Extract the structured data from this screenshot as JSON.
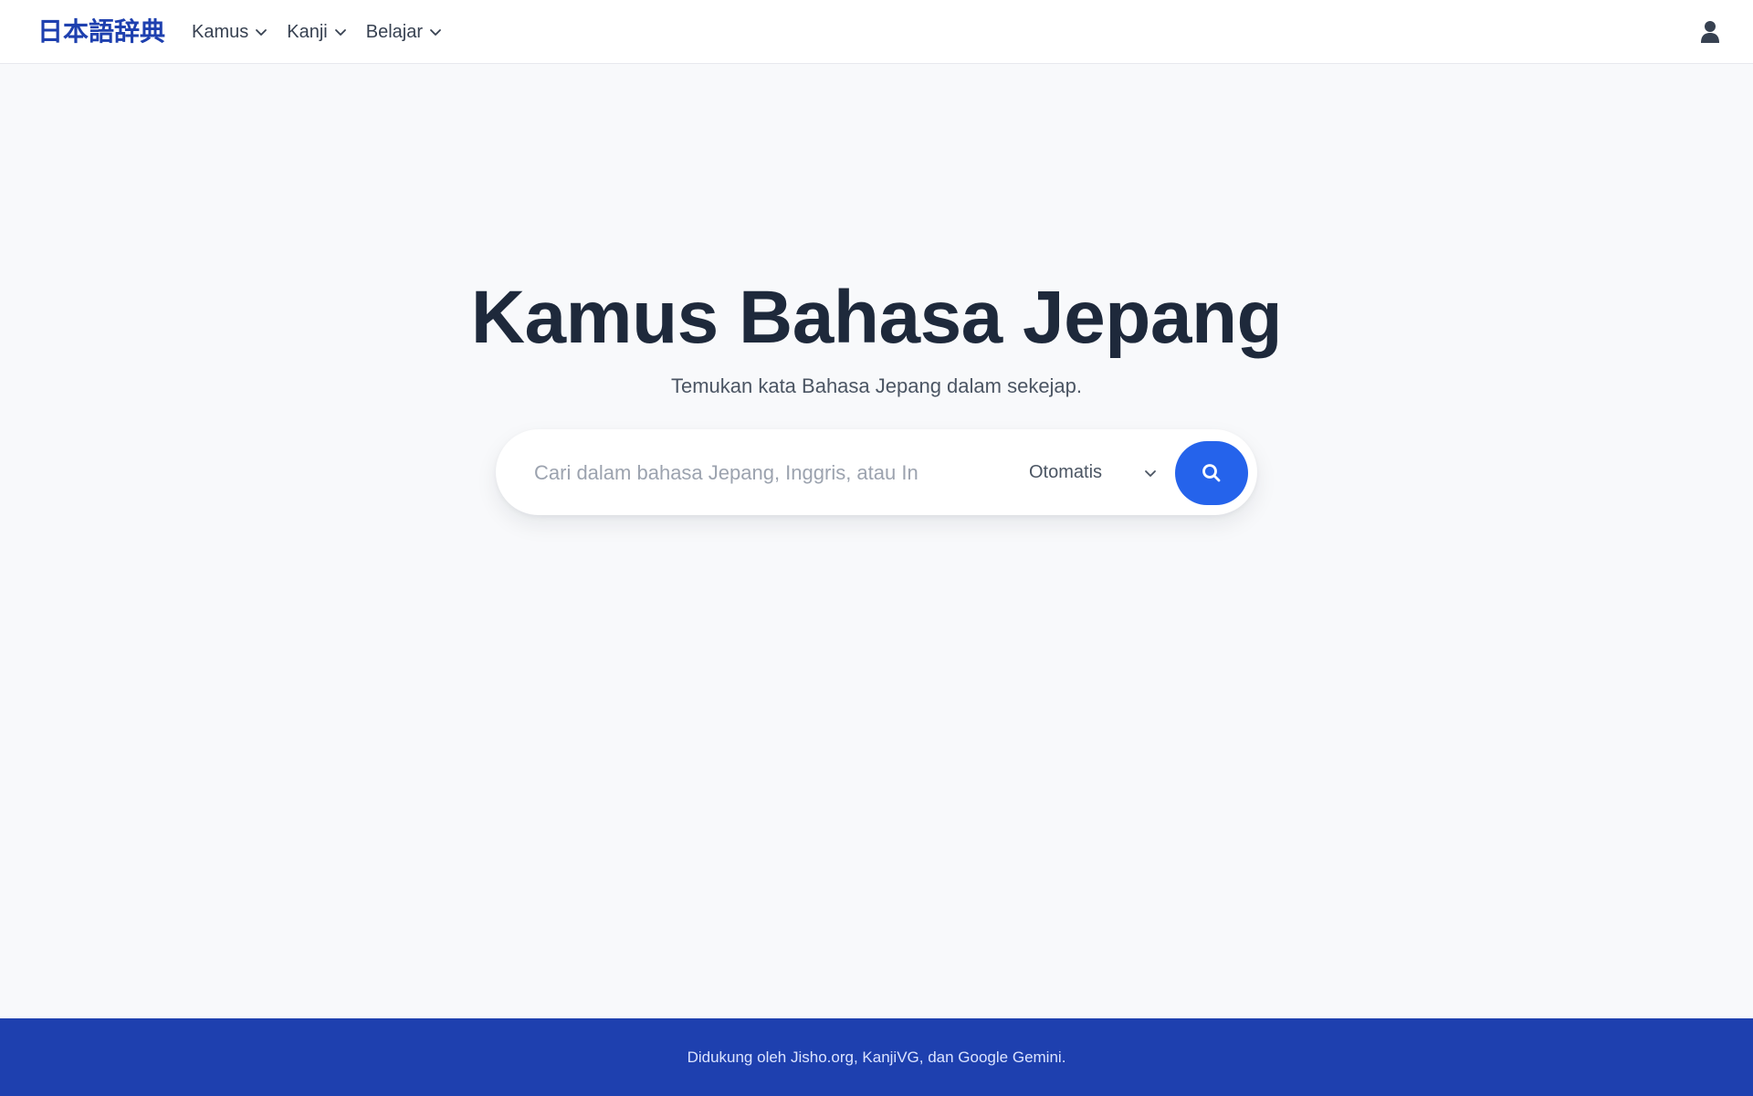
{
  "header": {
    "logo": "日本語辞典",
    "nav": [
      {
        "label": "Kamus",
        "icon": "chevron-down-icon"
      },
      {
        "label": "Kanji",
        "icon": "chevron-down-icon"
      },
      {
        "label": "Belajar",
        "icon": "chevron-down-icon"
      }
    ],
    "user_icon": "user-icon"
  },
  "hero": {
    "title": "Kamus Bahasa Jepang",
    "subtitle": "Temukan kata Bahasa Jepang dalam sekejap."
  },
  "search": {
    "placeholder": "Cari dalam bahasa Jepang, Inggris, atau In",
    "value": "",
    "mode_selected": "Otomatis",
    "button_icon": "search-icon"
  },
  "footer": {
    "text": "Didukung oleh Jisho.org, KanjiVG, dan Google Gemini."
  },
  "colors": {
    "brand": "#1e40af",
    "accent": "#2563eb",
    "background": "#f8f9fb",
    "title": "#1e293b"
  }
}
